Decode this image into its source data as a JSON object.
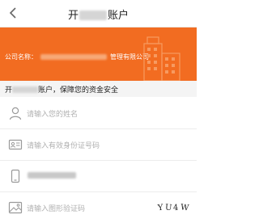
{
  "nav": {
    "title_prefix": "开",
    "title_suffix": "账户"
  },
  "banner": {
    "company_label": "公司名称：",
    "company_suffix": "管理有限公司",
    "accent_color": "#f26c21"
  },
  "notice": {
    "prefix": "开",
    "suffix": "账户，保障您的资金安全"
  },
  "form": {
    "name_placeholder": "请输入您的姓名",
    "id_placeholder": "请输入有效身份证号码",
    "captcha_placeholder": "请输入图形验证码",
    "captcha_text": [
      "Y",
      "U",
      "4",
      "W"
    ]
  }
}
